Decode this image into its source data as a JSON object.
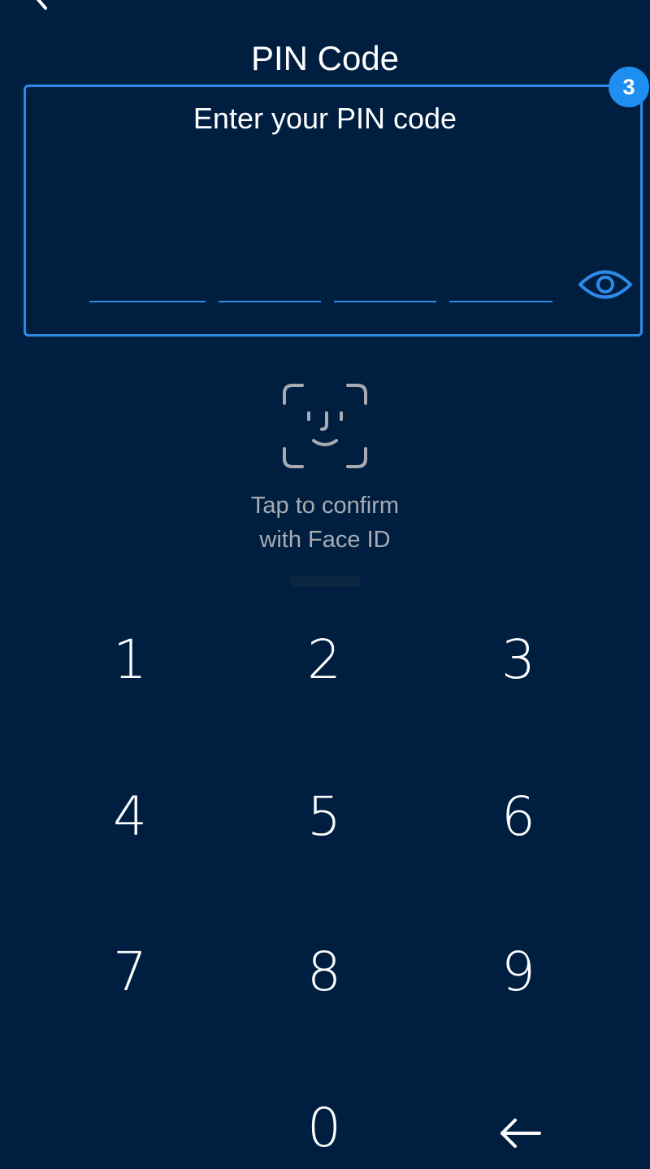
{
  "header": {
    "title": "PIN Code"
  },
  "pin_entry": {
    "prompt": "Enter your PIN code",
    "badge": "3",
    "digits_entered": 0,
    "digit_count": 4
  },
  "face_id": {
    "line1": "Tap to confirm",
    "line2": "with Face ID"
  },
  "keypad": {
    "keys": [
      "1",
      "2",
      "3",
      "4",
      "5",
      "6",
      "7",
      "8",
      "9",
      "0"
    ]
  },
  "colors": {
    "background": "#001f40",
    "accent": "#2e8ae6",
    "badge": "#1f8ef1",
    "muted_text": "#a8abb1"
  },
  "icons": [
    "back-arrow-icon",
    "eye-icon",
    "face-id-icon",
    "backspace-icon"
  ]
}
